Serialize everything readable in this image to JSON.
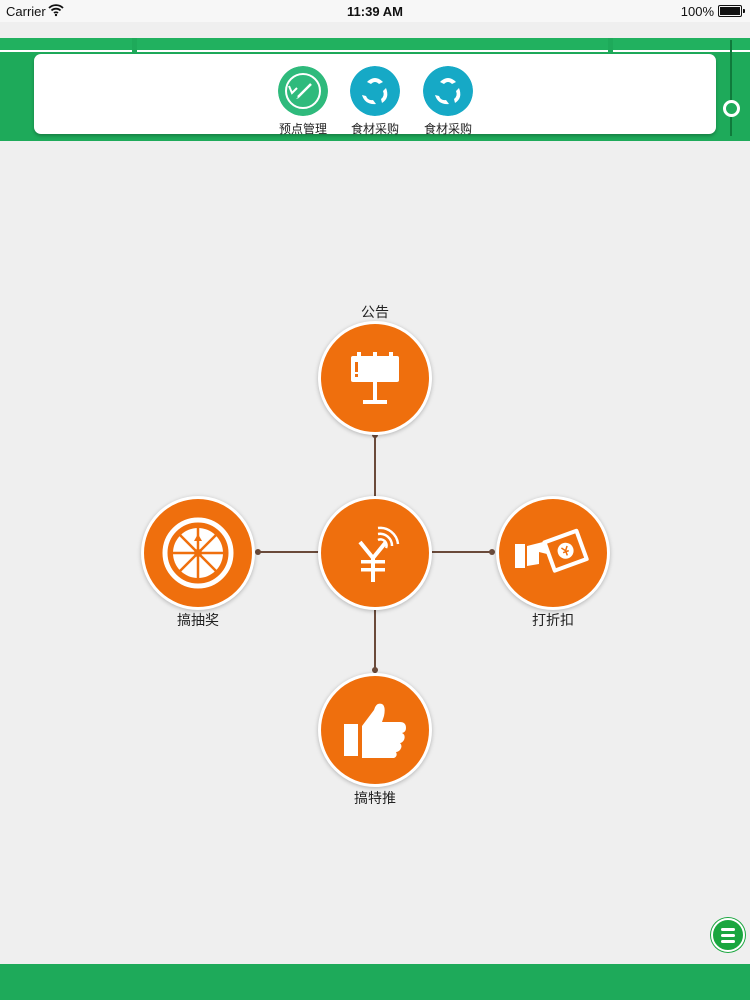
{
  "status_bar": {
    "carrier": "Carrier",
    "time": "11:39 AM",
    "battery": "100%"
  },
  "quick_actions": [
    {
      "label": "预点管理",
      "icon": "edit-refresh-icon",
      "color": "#2fba7c"
    },
    {
      "label": "食材采购",
      "icon": "recycle-icon",
      "color": "#16a9c6"
    },
    {
      "label": "食材采购",
      "icon": "recycle-icon",
      "color": "#16a9c6"
    }
  ],
  "menu": {
    "center": {
      "icon": "yuan-wireless-icon"
    },
    "top": {
      "label": "公告",
      "icon": "billboard-icon"
    },
    "left": {
      "label": "搞抽奖",
      "icon": "prize-wheel-icon"
    },
    "right": {
      "label": "打折扣",
      "icon": "discount-cash-icon"
    },
    "bottom": {
      "label": "搞特推",
      "icon": "thumbs-up-icon"
    }
  },
  "colors": {
    "header_green": "#1eaa5a",
    "node_orange": "#ef6f0d",
    "connector": "#6a4a3a",
    "background": "#efefef"
  }
}
